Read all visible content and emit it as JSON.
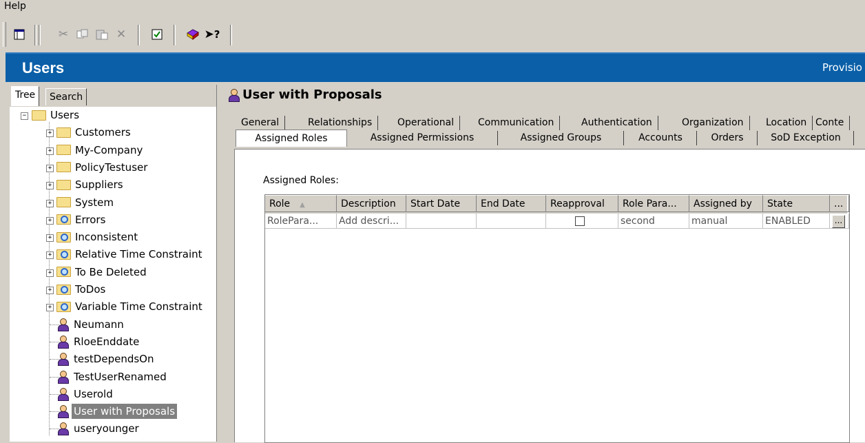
{
  "menu": {
    "help_label": "Help"
  },
  "toolbar": {
    "icons": [
      "tree-view-icon",
      "cut-icon",
      "copy-icon",
      "paste-icon",
      "delete-icon",
      "properties-icon",
      "book-icon",
      "whats-this-icon"
    ],
    "whats_this_label": "?"
  },
  "header": {
    "title": "Users",
    "right_text": "Provisio"
  },
  "tree_tabs": {
    "tree": "Tree",
    "search": "Search"
  },
  "tree": {
    "root": "Users",
    "folders": [
      "Customers",
      "My-Company",
      "PolicyTestuser",
      "Suppliers",
      "System"
    ],
    "queries": [
      "Errors",
      "Inconsistent",
      "Relative Time Constraint",
      "To Be Deleted",
      "ToDos",
      "Variable Time Constraint"
    ],
    "users": [
      "Neumann",
      "RloeEnddate",
      "testDependsOn",
      "TestUserRenamed",
      "Userold",
      "User with Proposals",
      "useryounger"
    ],
    "selected": "User with Proposals"
  },
  "detail": {
    "title": "User with Proposals",
    "tabs_row1": [
      "General",
      "Relationships",
      "Operational",
      "Communication",
      "Authentication",
      "Organization",
      "Location",
      "Conte"
    ],
    "tabs_row2": [
      "Assigned Roles",
      "Assigned Permissions",
      "Assigned Groups",
      "Accounts",
      "Orders",
      "SoD Exception"
    ],
    "active_tab": "Assigned Roles",
    "section_label": "Assigned Roles:"
  },
  "grid": {
    "columns": [
      "Role",
      "Description",
      "Start Date",
      "End Date",
      "Reapproval",
      "Role Para...",
      "Assigned by",
      "State",
      "..."
    ],
    "sort_column": "Role",
    "rows": [
      {
        "role": "RolePara...",
        "description": "Add descri...",
        "start_date": "",
        "end_date": "",
        "reapproval": false,
        "role_param": "second",
        "assigned_by": "manual",
        "state": "ENABLED",
        "more": "..."
      }
    ]
  },
  "colors": {
    "header_bg": "#0a5fa8",
    "window_bg": "#d4d0c8",
    "selection_bg": "#808080"
  }
}
